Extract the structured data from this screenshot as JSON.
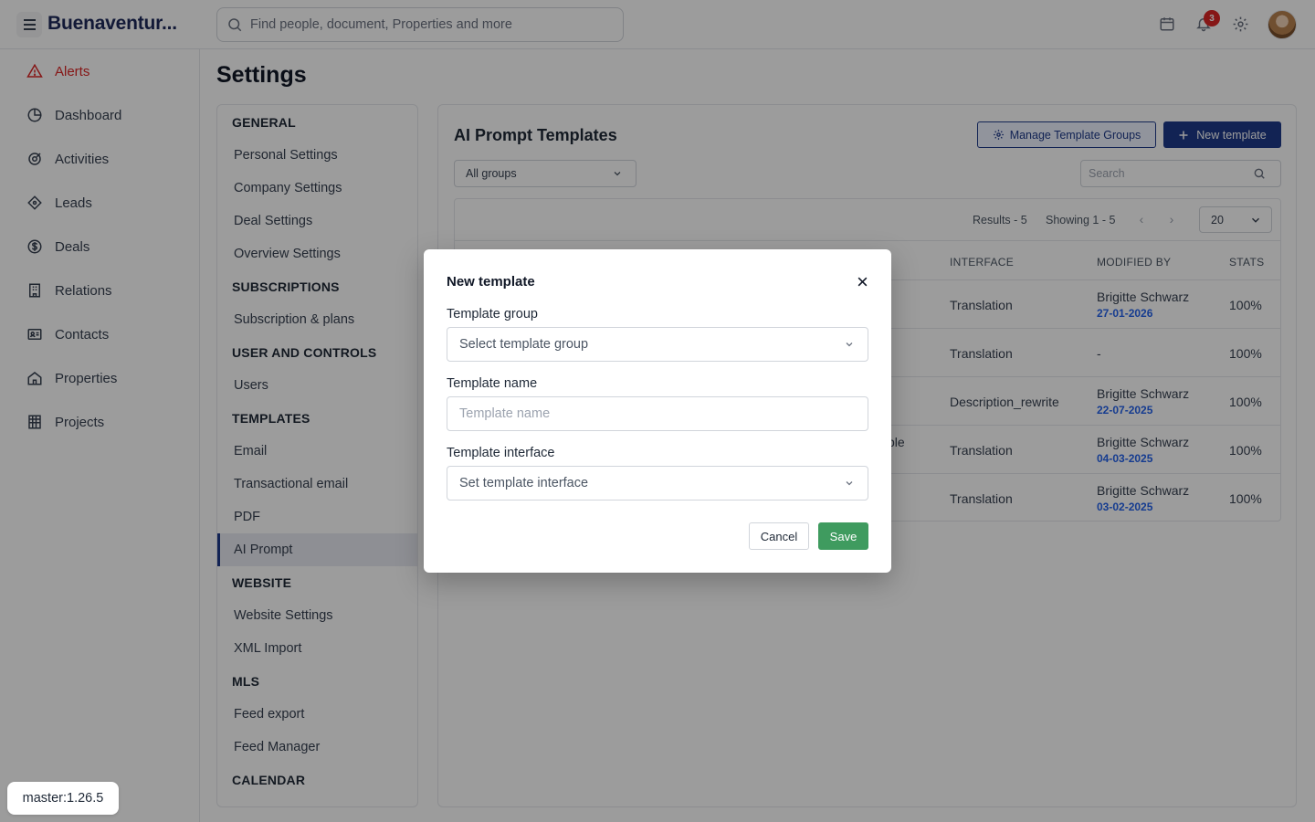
{
  "app": {
    "brand": "Buenaventur...",
    "search_placeholder": "Find people, document, Properties and more",
    "notification_count": "3"
  },
  "sidebar": {
    "items": [
      {
        "label": "Alerts",
        "icon": "alert-triangle-icon"
      },
      {
        "label": "Dashboard",
        "icon": "pie-chart-icon"
      },
      {
        "label": "Activities",
        "icon": "activities-icon"
      },
      {
        "label": "Leads",
        "icon": "leads-icon"
      },
      {
        "label": "Deals",
        "icon": "dollar-circle-icon"
      },
      {
        "label": "Relations",
        "icon": "building-icon"
      },
      {
        "label": "Contacts",
        "icon": "contact-card-icon"
      },
      {
        "label": "Properties",
        "icon": "home-icon"
      },
      {
        "label": "Projects",
        "icon": "projects-icon"
      }
    ]
  },
  "page": {
    "title": "Settings"
  },
  "settings_nav": {
    "sections": [
      {
        "heading": "GENERAL",
        "items": [
          "Personal Settings",
          "Company Settings",
          "Deal Settings",
          "Overview Settings"
        ]
      },
      {
        "heading": "SUBSCRIPTIONS",
        "items": [
          "Subscription & plans"
        ]
      },
      {
        "heading": "USER AND CONTROLS",
        "items": [
          "Users"
        ]
      },
      {
        "heading": "TEMPLATES",
        "items": [
          "Email",
          "Transactional email",
          "PDF",
          "AI Prompt"
        ]
      },
      {
        "heading": "WEBSITE",
        "items": [
          "Website Settings",
          "XML Import"
        ]
      },
      {
        "heading": "MLS",
        "items": [
          "Feed export",
          "Feed Manager"
        ]
      },
      {
        "heading": "CALENDAR",
        "items": []
      }
    ],
    "active_item": "AI Prompt"
  },
  "panel": {
    "title": "AI Prompt Templates",
    "manage_button": "Manage Template Groups",
    "new_button": "New template",
    "group_filter": "All groups",
    "search_placeholder": "Search",
    "results": "Results - 5",
    "showing": "Showing 1 - 5",
    "per_page": "20",
    "columns": [
      "INTERFACE",
      "MODIFIED BY",
      "STATS"
    ],
    "rows": [
      {
        "partial": "",
        "interface": "Translation",
        "modified_by": "Brigitte Schwarz",
        "date": "27-01-2026",
        "stats": "100%"
      },
      {
        "partial": "",
        "interface": "Translation",
        "modified_by": "-",
        "date": "",
        "stats": "100%"
      },
      {
        "partial": "",
        "interface": "Description_rewrite",
        "modified_by": "Brigitte Schwarz",
        "date": "22-07-2025",
        "stats": "100%"
      },
      {
        "partial": "ble",
        "interface": "Translation",
        "modified_by": "Brigitte Schwarz",
        "date": "04-03-2025",
        "stats": "100%"
      },
      {
        "partial": "",
        "interface": "Translation",
        "modified_by": "Brigitte Schwarz",
        "date": "03-02-2025",
        "stats": "100%"
      }
    ]
  },
  "modal": {
    "title": "New template",
    "group_label": "Template group",
    "group_placeholder": "Select template group",
    "name_label": "Template name",
    "name_placeholder": "Template name",
    "interface_label": "Template interface",
    "interface_placeholder": "Set template interface",
    "cancel": "Cancel",
    "save": "Save"
  },
  "version": "master:1.26.5",
  "colors": {
    "brand_navy": "#1e3a8a",
    "alert_red": "#dc2626",
    "save_green": "#3f9b5f",
    "date_blue": "#2563eb"
  }
}
